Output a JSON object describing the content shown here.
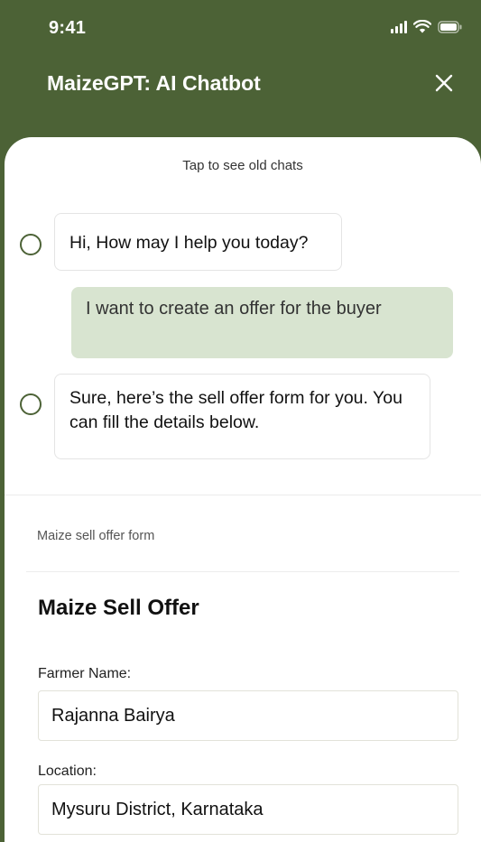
{
  "status_bar": {
    "time": "9:41"
  },
  "header": {
    "title": "MaizeGPT: AI Chatbot"
  },
  "chat": {
    "old_chats_label": "Tap to see old chats",
    "messages": [
      {
        "sender": "bot",
        "text": "Hi, How may I help you today?"
      },
      {
        "sender": "user",
        "text": "I want to create an offer for the buyer"
      },
      {
        "sender": "bot",
        "text": "Sure, here’s the sell offer form for you. You can fill the details below."
      }
    ]
  },
  "form": {
    "section_label": "Maize sell offer form",
    "title": "Maize Sell Offer",
    "fields": [
      {
        "label": "Farmer Name:",
        "value": "Rajanna Bairya"
      },
      {
        "label": "Location:",
        "value": "Mysuru District, Karnataka"
      }
    ]
  },
  "colors": {
    "brand_green": "#4c6236",
    "user_bubble": "#d8e4d0"
  }
}
